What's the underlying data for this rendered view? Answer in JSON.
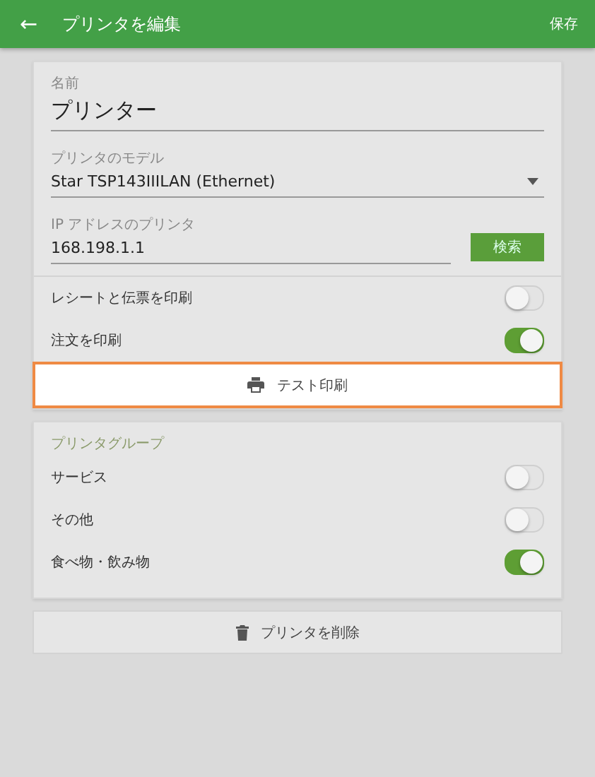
{
  "header": {
    "back": "←",
    "title": "プリンタを編集",
    "save": "保存"
  },
  "form": {
    "name": {
      "label": "名前",
      "value": "プリンター"
    },
    "model": {
      "label": "プリンタのモデル",
      "value": "Star TSP143IIILAN (Ethernet)"
    },
    "ip": {
      "label": "IP アドレスのプリンタ",
      "value": "168.198.1.1",
      "button": "検索"
    }
  },
  "print_options": [
    {
      "label": "レシートと伝票を印刷",
      "on": false
    },
    {
      "label": "注文を印刷",
      "on": true
    }
  ],
  "test_print": {
    "label": "テスト印刷",
    "focused": true
  },
  "groups": {
    "title": "プリンタグループ",
    "items": [
      {
        "label": "サービス",
        "on": false
      },
      {
        "label": "その他",
        "on": false
      },
      {
        "label": "食べ物・飲み物",
        "on": true
      }
    ]
  },
  "delete": {
    "label": "プリンタを削除"
  }
}
